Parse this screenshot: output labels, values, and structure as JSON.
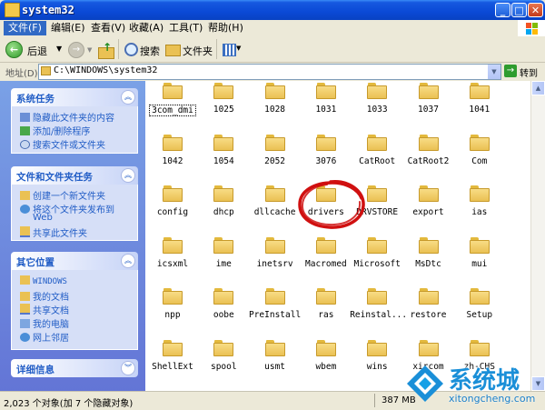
{
  "window": {
    "title": "system32"
  },
  "menu": [
    "文件(F)",
    "编辑(E)",
    "查看(V)",
    "收藏(A)",
    "工具(T)",
    "帮助(H)"
  ],
  "toolbar": {
    "back": "后退",
    "search": "搜索",
    "folders": "文件夹"
  },
  "address": {
    "label": "地址(D)",
    "path": "C:\\WINDOWS\\system32",
    "go": "转到"
  },
  "sidebar": {
    "system_tasks": {
      "title": "系统任务",
      "items": [
        "隐藏此文件夹的内容",
        "添加/删除程序",
        "搜索文件或文件夹"
      ]
    },
    "file_tasks": {
      "title": "文件和文件夹任务",
      "items": [
        "创建一个新文件夹",
        "将这个文件夹发布到",
        "Web",
        "共享此文件夹"
      ]
    },
    "other_places": {
      "title": "其它位置",
      "items": [
        "WINDOWS",
        "我的文档",
        "共享文档",
        "我的电脑",
        "网上邻居"
      ]
    },
    "details": {
      "title": "详细信息"
    }
  },
  "folders": [
    "3com_dmi",
    "1025",
    "1028",
    "1031",
    "1033",
    "1037",
    "1041",
    "1042",
    "1054",
    "2052",
    "3076",
    "CatRoot",
    "CatRoot2",
    "Com",
    "config",
    "dhcp",
    "dllcache",
    "drivers",
    "DRVSTORE",
    "export",
    "ias",
    "icsxml",
    "ime",
    "inetsrv",
    "Macromed",
    "Microsoft",
    "MsDtc",
    "mui",
    "npp",
    "oobe",
    "PreInstall",
    "ras",
    "Reinstal...",
    "restore",
    "Setup",
    "ShellExt",
    "spool",
    "usmt",
    "wbem",
    "wins",
    "xircom",
    "zh-CHS"
  ],
  "status": {
    "left": "2,023 个对象(加 7 个隐藏对象)",
    "size": "387 MB"
  },
  "watermark": {
    "brand": "系统城",
    "url": "xitongcheng.com"
  },
  "colors": {
    "accent": "#316ac5",
    "titlebar": "#0a49d6",
    "sidebar_link": "#215dc6",
    "annotation": "#d01010"
  }
}
